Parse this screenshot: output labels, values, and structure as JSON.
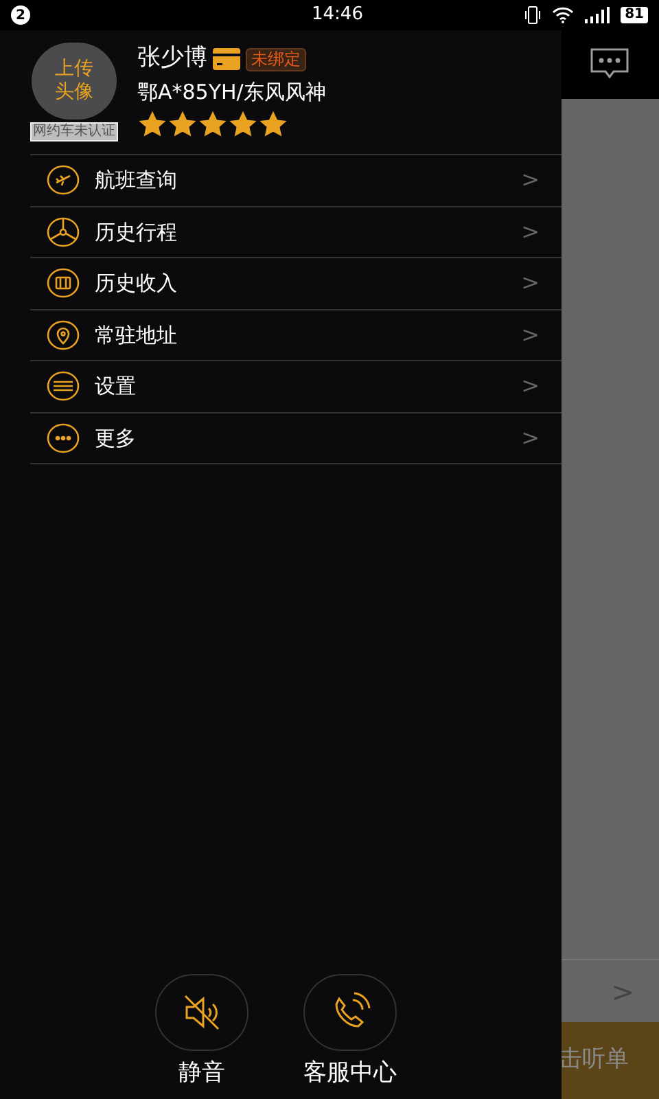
{
  "status_bar": {
    "notification_count": "2",
    "time": "14:46",
    "battery": "81"
  },
  "background": {
    "row_chevron": ">",
    "button_label": "击听单"
  },
  "profile": {
    "avatar_label": "上传头像",
    "certification": "网约车未认证",
    "name": "张少博",
    "badge": "未绑定",
    "vehicle": "鄂A*85YH/东风风神",
    "stars": 5
  },
  "menu": [
    {
      "kind": "flight",
      "label": "航班查询",
      "chevron": ">"
    },
    {
      "kind": "steering",
      "label": "历史行程",
      "chevron": ">"
    },
    {
      "kind": "wallet",
      "label": "历史收入",
      "chevron": ">"
    },
    {
      "kind": "location",
      "label": "常驻地址",
      "chevron": ">"
    },
    {
      "kind": "settings",
      "label": "设置",
      "chevron": ">"
    },
    {
      "kind": "more",
      "label": "更多",
      "chevron": ">"
    }
  ],
  "bottom_actions": [
    {
      "kind": "mute",
      "label": "静音"
    },
    {
      "kind": "phone",
      "label": "客服中心"
    }
  ]
}
